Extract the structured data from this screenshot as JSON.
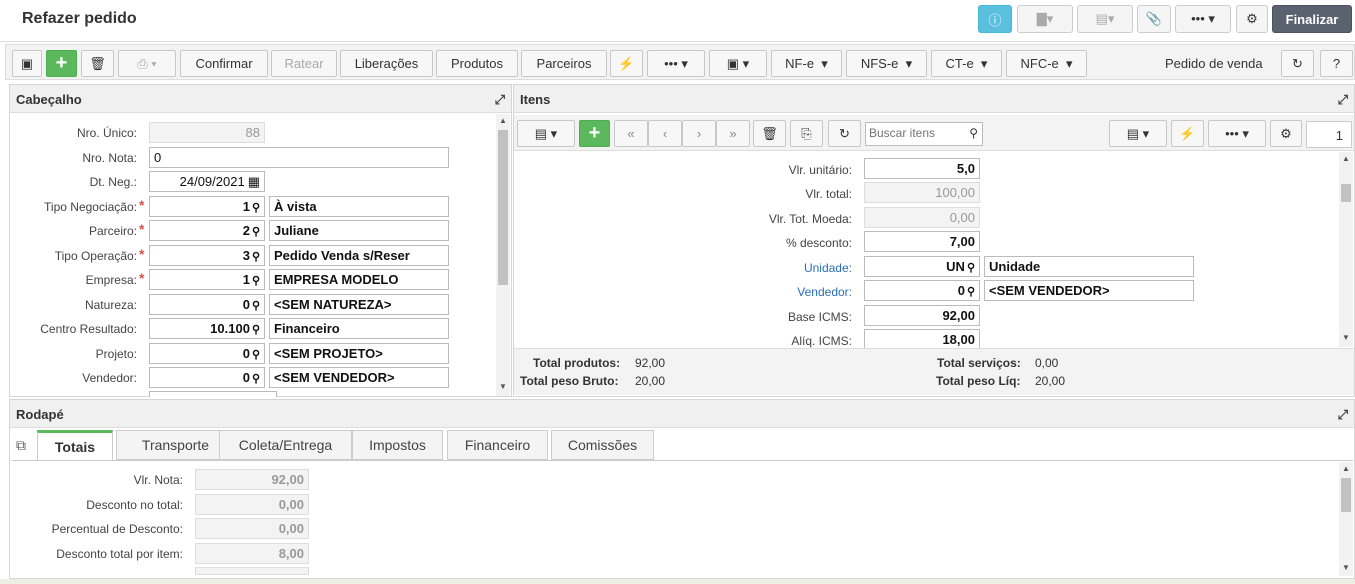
{
  "app": {
    "title": "Refazer pedido",
    "finalize_label": "Finalizar",
    "pedido_type": "Pedido de venda"
  },
  "toolbar": {
    "confirm": "Confirmar",
    "ratear": "Ratear",
    "liberacoes": "Liberações",
    "produtos": "Produtos",
    "parceiros": "Parceiros",
    "nfe": "NF-e",
    "nfse": "NFS-e",
    "cte": "CT-e",
    "nfce": "NFC-e"
  },
  "header": {
    "title": "Cabeçalho",
    "fields": [
      {
        "label": "Nro. Único:",
        "value": "88"
      },
      {
        "label": "Nro. Nota:",
        "value": "0"
      },
      {
        "label": "Dt. Neg.:",
        "value": "24/09/2021"
      },
      {
        "label": "Tipo Negociação:",
        "code": "1",
        "desc": "À vista"
      },
      {
        "label": "Parceiro:",
        "code": "2",
        "desc": "Juliane"
      },
      {
        "label": "Tipo Operação:",
        "code": "3",
        "desc": "Pedido Venda s/Reser"
      },
      {
        "label": "Empresa:",
        "code": "1",
        "desc": "EMPRESA MODELO"
      },
      {
        "label": "Natureza:",
        "code": "0",
        "desc": "<SEM NATUREZA>"
      },
      {
        "label": "Centro Resultado:",
        "code": "10.100",
        "desc": "Financeiro"
      },
      {
        "label": "Projeto:",
        "code": "0",
        "desc": "<SEM PROJETO>"
      },
      {
        "label": "Vendedor:",
        "code": "0",
        "desc": "<SEM VENDEDOR>"
      }
    ]
  },
  "items": {
    "title": "Itens",
    "search_placeholder": "Buscar itens",
    "page": "1",
    "fields": [
      {
        "label": "Vlr. unitário:",
        "value": "5,0"
      },
      {
        "label": "Vlr. total:",
        "value": "100,00"
      },
      {
        "label": "Vlr. Tot. Moeda:",
        "value": "0,00"
      },
      {
        "label": "% desconto:",
        "value": "7,00"
      },
      {
        "label": "Unidade:",
        "code": "UN",
        "desc": "Unidade"
      },
      {
        "label": "Vendedor:",
        "code": "0",
        "desc": "<SEM VENDEDOR>"
      },
      {
        "label": "Base ICMS:",
        "value": "92,00"
      },
      {
        "label": "Alíq. ICMS:",
        "value": "18,00"
      }
    ],
    "totals": {
      "produtos_label": "Total produtos:",
      "produtos": "92,00",
      "servicos_label": "Total serviços:",
      "servicos": "0,00",
      "peso_bruto_label": "Total peso Bruto:",
      "peso_bruto": "20,00",
      "peso_liq_label": "Total peso Líq:",
      "peso_liq": "20,00"
    }
  },
  "footer": {
    "title": "Rodapé",
    "tabs": [
      "Totais",
      "Transporte",
      "Coleta/Entrega",
      "Impostos",
      "Financeiro",
      "Comissões"
    ],
    "fields": [
      {
        "label": "Vlr. Nota:",
        "value": "92,00"
      },
      {
        "label": "Desconto no total:",
        "value": "0,00"
      },
      {
        "label": "Percentual de Desconto:",
        "value": "0,00"
      },
      {
        "label": "Desconto total por item:",
        "value": "8,00"
      }
    ]
  }
}
